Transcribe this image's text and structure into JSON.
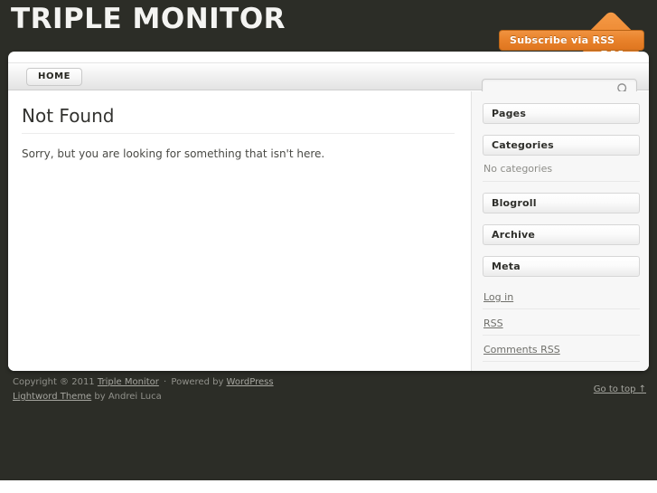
{
  "site": {
    "title": "TRIPLE MONITOR",
    "background_color": "#2c2d27",
    "accent_color": "#e8812a"
  },
  "rss": {
    "label": "Subscribe via RSS",
    "icon": "rss-icon"
  },
  "nav": {
    "items": [
      {
        "label": "HOME"
      }
    ]
  },
  "search": {
    "value": "",
    "placeholder": "",
    "icon": "search-icon"
  },
  "main": {
    "heading": "Not Found",
    "body": "Sorry, but you are looking for something that isn't here."
  },
  "sidebar": {
    "widgets": [
      {
        "title": "Pages",
        "empty_text": ""
      },
      {
        "title": "Categories",
        "empty_text": "No categories"
      },
      {
        "title": "Blogroll",
        "empty_text": ""
      },
      {
        "title": "Archive",
        "empty_text": ""
      },
      {
        "title": "Meta",
        "empty_text": ""
      }
    ],
    "meta_links": [
      {
        "label": "Log in"
      },
      {
        "label": "RSS"
      },
      {
        "label": "Comments RSS"
      }
    ]
  },
  "footer": {
    "copyright_prefix": "Copyright ®  2011 ",
    "site_link": "Triple Monitor",
    "separator": " · ",
    "powered_by": "Powered by ",
    "platform_link": "WordPress",
    "theme_link": "Lightword Theme",
    "theme_author": " by Andrei Luca",
    "go_to_top": "Go to top ↑"
  }
}
